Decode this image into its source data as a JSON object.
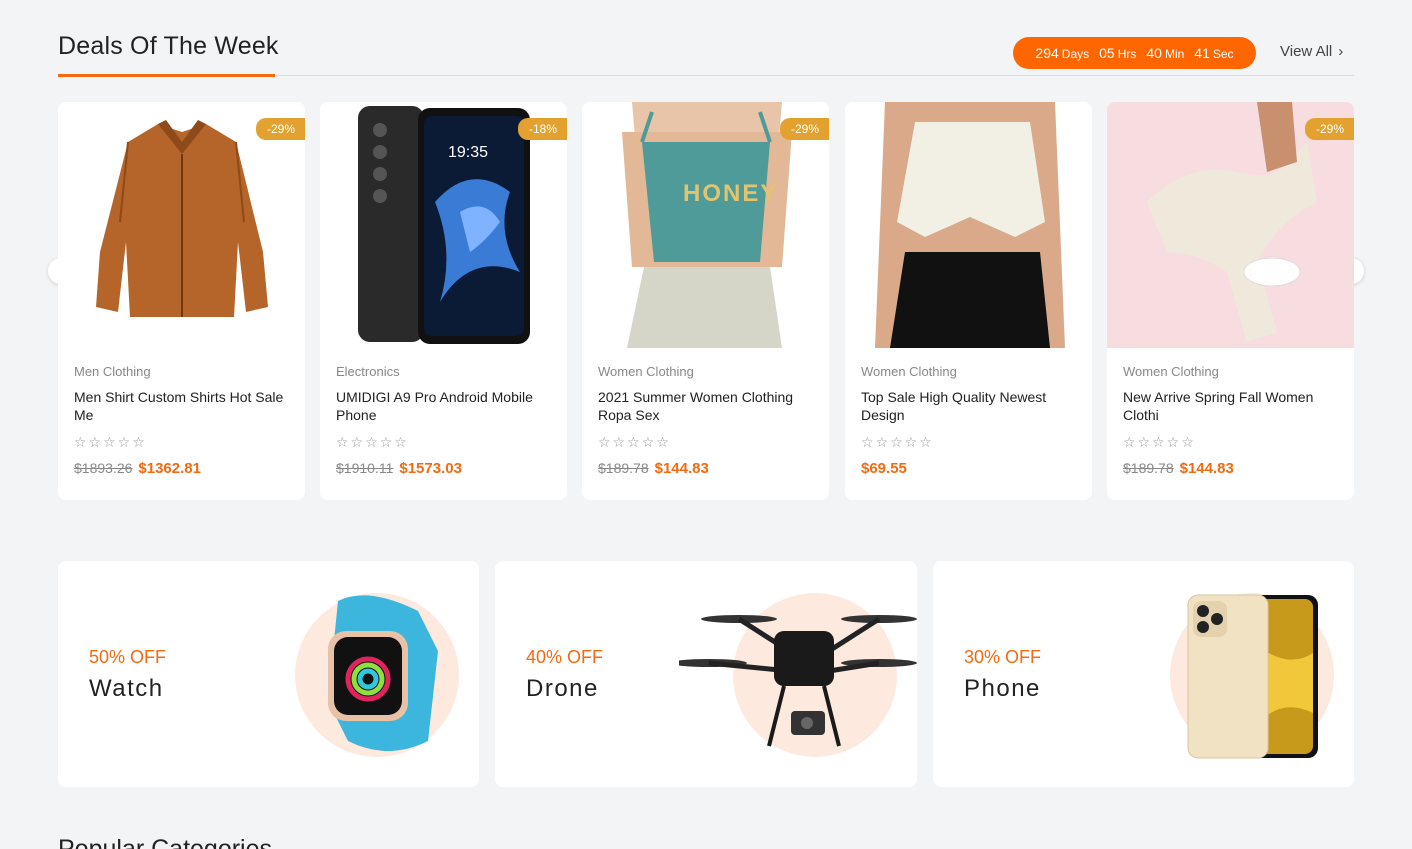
{
  "section": {
    "title": "Deals Of The Week",
    "view_all": "View All"
  },
  "countdown": {
    "days": "294",
    "days_unit": "Days",
    "hrs": "05",
    "hrs_unit": "Hrs",
    "min": "40",
    "min_unit": "Min",
    "sec": "41",
    "sec_unit": "Sec"
  },
  "products": [
    {
      "badge": "-29%",
      "category": "Men Clothing",
      "name": "Men Shirt Custom Shirts Hot Sale Me",
      "stars": "☆☆☆☆☆",
      "old_price": "$1893.26",
      "price": "$1362.81"
    },
    {
      "badge": "-18%",
      "category": "Electronics",
      "name": "UMIDIGI A9 Pro Android Mobile Phone",
      "stars": "☆☆☆☆☆",
      "old_price": "$1910.11",
      "price": "$1573.03"
    },
    {
      "badge": "-29%",
      "category": "Women Clothing",
      "name": "2021 Summer Women Clothing Ropa Sex",
      "stars": "☆☆☆☆☆",
      "old_price": "$189.78",
      "price": "$144.83"
    },
    {
      "badge": "",
      "category": "Women Clothing",
      "name": "Top Sale High Quality Newest Design",
      "stars": "☆☆☆☆☆",
      "old_price": "",
      "price": "$69.55"
    },
    {
      "badge": "-29%",
      "category": "Women Clothing",
      "name": "New Arrive Spring Fall Women Clothi",
      "stars": "☆☆☆☆☆",
      "old_price": "$189.78",
      "price": "$144.83"
    }
  ],
  "product_image_text": {
    "phone_time": "19:35",
    "tank_print": "HONEY"
  },
  "promos": [
    {
      "off": "50% OFF",
      "label": "Watch"
    },
    {
      "off": "40% OFF",
      "label": "Drone"
    },
    {
      "off": "30% OFF",
      "label": "Phone"
    }
  ],
  "next_section": {
    "title": "Popular Categories"
  },
  "colors": {
    "accent": "#ff6600",
    "badge": "#e3a22f",
    "price": "#f36a10"
  },
  "icons": {
    "prev": "chevron-left-icon",
    "next": "chevron-right-icon",
    "view_all": "chevron-right-icon"
  }
}
